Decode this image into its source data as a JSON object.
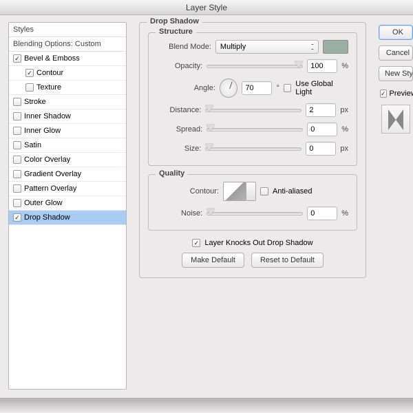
{
  "window": {
    "title": "Layer Style"
  },
  "sidebar": {
    "header": "Styles",
    "subheader": "Blending Options: Custom",
    "items": [
      {
        "label": "Bevel & Emboss",
        "checked": true,
        "indent": false
      },
      {
        "label": "Contour",
        "checked": true,
        "indent": true
      },
      {
        "label": "Texture",
        "checked": false,
        "indent": true
      },
      {
        "label": "Stroke",
        "checked": false,
        "indent": false
      },
      {
        "label": "Inner Shadow",
        "checked": false,
        "indent": false
      },
      {
        "label": "Inner Glow",
        "checked": false,
        "indent": false
      },
      {
        "label": "Satin",
        "checked": false,
        "indent": false
      },
      {
        "label": "Color Overlay",
        "checked": false,
        "indent": false
      },
      {
        "label": "Gradient Overlay",
        "checked": false,
        "indent": false
      },
      {
        "label": "Pattern Overlay",
        "checked": false,
        "indent": false
      },
      {
        "label": "Outer Glow",
        "checked": false,
        "indent": false
      },
      {
        "label": "Drop Shadow",
        "checked": true,
        "indent": false,
        "selected": true
      }
    ]
  },
  "panel": {
    "title": "Drop Shadow",
    "structure": {
      "title": "Structure",
      "blendmode_label": "Blend Mode:",
      "blendmode_value": "Multiply",
      "color": "#9ab0a5",
      "opacity_label": "Opacity:",
      "opacity_value": "100",
      "opacity_unit": "%",
      "angle_label": "Angle:",
      "angle_value": "70",
      "angle_unit": "°",
      "use_global_label": "Use Global Light",
      "use_global_checked": false,
      "distance_label": "Distance:",
      "distance_value": "2",
      "distance_unit": "px",
      "spread_label": "Spread:",
      "spread_value": "0",
      "spread_unit": "%",
      "size_label": "Size:",
      "size_value": "0",
      "size_unit": "px"
    },
    "quality": {
      "title": "Quality",
      "contour_label": "Contour:",
      "antialiased_label": "Anti-aliased",
      "antialiased_checked": false,
      "noise_label": "Noise:",
      "noise_value": "0",
      "noise_unit": "%"
    },
    "knockout_label": "Layer Knocks Out Drop Shadow",
    "knockout_checked": true,
    "make_default": "Make Default",
    "reset_default": "Reset to Default"
  },
  "rightcol": {
    "ok": "OK",
    "cancel": "Cancel",
    "new_style": "New Style...",
    "preview": "Preview",
    "preview_checked": true
  }
}
